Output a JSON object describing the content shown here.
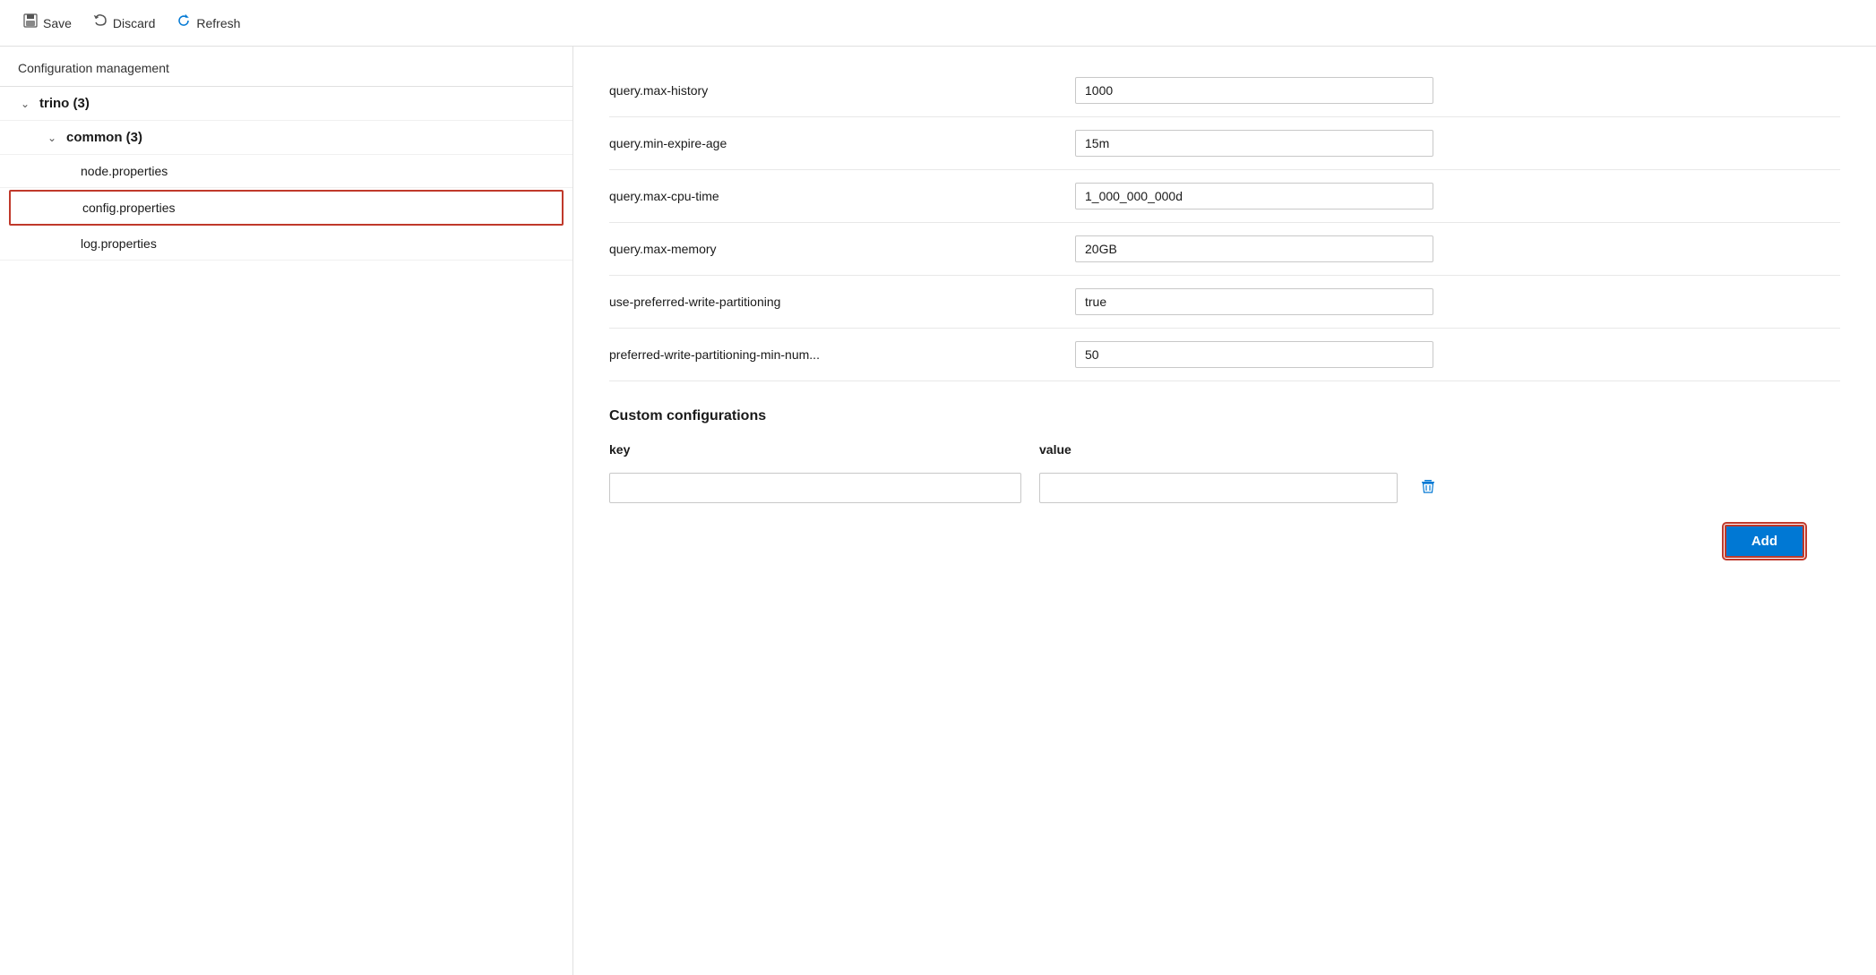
{
  "toolbar": {
    "save_label": "Save",
    "discard_label": "Discard",
    "refresh_label": "Refresh"
  },
  "sidebar": {
    "header": "Configuration management",
    "tree": [
      {
        "id": "trino",
        "label": "trino (3)",
        "level": 0,
        "expanded": true,
        "bold": true,
        "has_chevron": true
      },
      {
        "id": "common",
        "label": "common (3)",
        "level": 1,
        "expanded": true,
        "bold": true,
        "has_chevron": true
      },
      {
        "id": "node-properties",
        "label": "node.properties",
        "level": 2,
        "selected": false,
        "has_chevron": false
      },
      {
        "id": "config-properties",
        "label": "config.properties",
        "level": 2,
        "selected": true,
        "has_chevron": false
      },
      {
        "id": "log-properties",
        "label": "log.properties",
        "level": 2,
        "selected": false,
        "has_chevron": false
      }
    ]
  },
  "config": {
    "rows": [
      {
        "key": "query.max-history",
        "value": "1000"
      },
      {
        "key": "query.min-expire-age",
        "value": "15m"
      },
      {
        "key": "query.max-cpu-time",
        "value": "1_000_000_000d"
      },
      {
        "key": "query.max-memory",
        "value": "20GB"
      },
      {
        "key": "use-preferred-write-partitioning",
        "value": "true"
      },
      {
        "key": "preferred-write-partitioning-min-num...",
        "value": "50"
      }
    ]
  },
  "custom": {
    "section_title": "Custom configurations",
    "key_header": "key",
    "value_header": "value",
    "rows": [
      {
        "key": "",
        "value": ""
      }
    ],
    "add_label": "Add"
  }
}
